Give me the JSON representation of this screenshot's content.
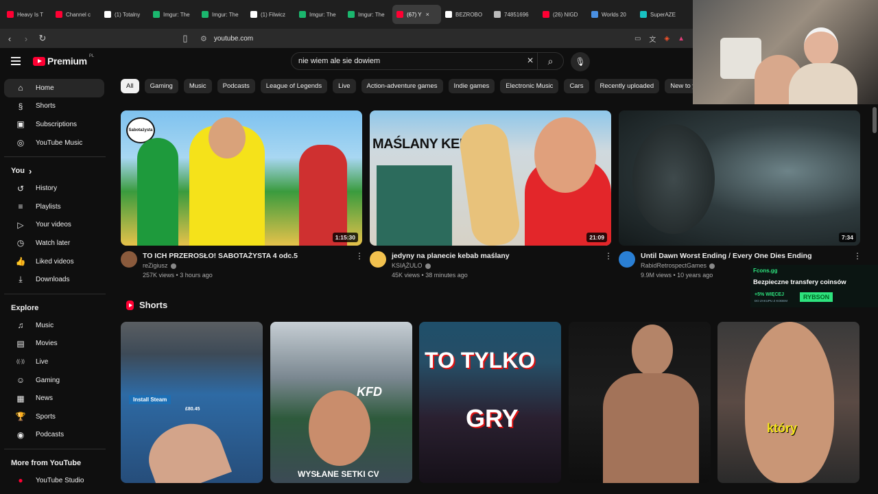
{
  "browser": {
    "tabs": [
      {
        "title": "Heavy Is T",
        "color": "#ff0033"
      },
      {
        "title": "Channel c",
        "color": "#ff0033"
      },
      {
        "title": "(1) Totalny",
        "color": "#ffffff"
      },
      {
        "title": "Imgur: The",
        "color": "#1bb76e"
      },
      {
        "title": "Imgur: The",
        "color": "#1bb76e"
      },
      {
        "title": "(1) Filwicz",
        "color": "#ffffff"
      },
      {
        "title": "Imgur: The",
        "color": "#1bb76e"
      },
      {
        "title": "Imgur: The",
        "color": "#1bb76e"
      },
      {
        "title": "(67) Y",
        "color": "#ff0033",
        "active": true
      },
      {
        "title": "BEZROBO",
        "color": "#ffffff"
      },
      {
        "title": "74851696",
        "color": "#bbbbbb"
      },
      {
        "title": "(26) NIGD",
        "color": "#ff0033"
      },
      {
        "title": "Worlds 20",
        "color": "#4a90e2"
      },
      {
        "title": "SuperAZE",
        "color": "#18c2c2"
      }
    ],
    "url": "youtube.com"
  },
  "header": {
    "logo_text": "Premium",
    "country_code": "PL",
    "search_query": "nie wiem ale sie dowiem"
  },
  "sidebar": {
    "main": [
      {
        "label": "Home",
        "icon": "home-icon",
        "glyph": "⌂",
        "active": true
      },
      {
        "label": "Shorts",
        "icon": "shorts-icon",
        "glyph": "§"
      },
      {
        "label": "Subscriptions",
        "icon": "subscriptions-icon",
        "glyph": "▣"
      }
    ],
    "music": {
      "label": "YouTube Music",
      "icon": "youtube-music-icon",
      "glyph": "◎"
    },
    "you_header": "You",
    "you": [
      {
        "label": "History",
        "icon": "history-icon",
        "glyph": "↺"
      },
      {
        "label": "Playlists",
        "icon": "playlists-icon",
        "glyph": "≡"
      },
      {
        "label": "Your videos",
        "icon": "your-videos-icon",
        "glyph": "▷"
      },
      {
        "label": "Watch later",
        "icon": "watch-later-icon",
        "glyph": "◷"
      },
      {
        "label": "Liked videos",
        "icon": "liked-videos-icon",
        "glyph": "👍"
      },
      {
        "label": "Downloads",
        "icon": "downloads-icon",
        "glyph": "⤓"
      }
    ],
    "explore_header": "Explore",
    "explore": [
      {
        "label": "Music",
        "icon": "music-icon",
        "glyph": "♫"
      },
      {
        "label": "Movies",
        "icon": "movies-icon",
        "glyph": "▤"
      },
      {
        "label": "Live",
        "icon": "live-icon",
        "glyph": "((·))"
      },
      {
        "label": "Gaming",
        "icon": "gaming-icon",
        "glyph": "☺"
      },
      {
        "label": "News",
        "icon": "news-icon",
        "glyph": "▦"
      },
      {
        "label": "Sports",
        "icon": "sports-icon",
        "glyph": "🏆"
      },
      {
        "label": "Podcasts",
        "icon": "podcasts-icon",
        "glyph": "◉"
      }
    ],
    "more_header": "More from YouTube",
    "more": [
      {
        "label": "YouTube Studio",
        "icon": "youtube-studio-icon",
        "glyph": "●"
      }
    ]
  },
  "chips": [
    "All",
    "Gaming",
    "Music",
    "Podcasts",
    "League of Legends",
    "Live",
    "Action-adventure games",
    "Indie games",
    "Electronic Music",
    "Cars",
    "Recently uploaded",
    "New to you"
  ],
  "videos": [
    {
      "title": "TO ICH PRZEROSŁO! SABOTAŻYSTA 4 odc.5",
      "channel": "reZigiusz",
      "views": "257K views",
      "age": "3 hours ago",
      "duration": "1:15:30",
      "thumb_text": "Sabotażysta"
    },
    {
      "title": "jedyny na planecie kebab maślany",
      "channel": "KSIĄŻULO",
      "views": "45K views",
      "age": "38 minutes ago",
      "duration": "21:09",
      "thumb_text": "MAŚLANY KEBAB"
    },
    {
      "title": "Until Dawn Worst Ending / Every One Dies Ending",
      "channel": "RabidRetrospectGames",
      "views": "9.9M views",
      "age": "10 years ago",
      "duration": "7:34"
    }
  ],
  "shorts_header": "Shorts",
  "shorts": [
    {
      "overlay": "Install Steam",
      "sub": "£80.45"
    },
    {
      "overlay": "KFD",
      "sub": "WYSŁANE SETKI CV"
    },
    {
      "overlay": "TO TYLKO",
      "sub": "GRY"
    },
    {
      "overlay": ""
    },
    {
      "overlay": "który"
    }
  ],
  "ad_overlay": {
    "brand": "Fcons.gg",
    "headline": "Bezpieczne transfery coinsów",
    "promo": "+5% WIĘCEJ",
    "promo_small": "DO ZAKUPU Z KODEM",
    "code": "RYBSON"
  }
}
